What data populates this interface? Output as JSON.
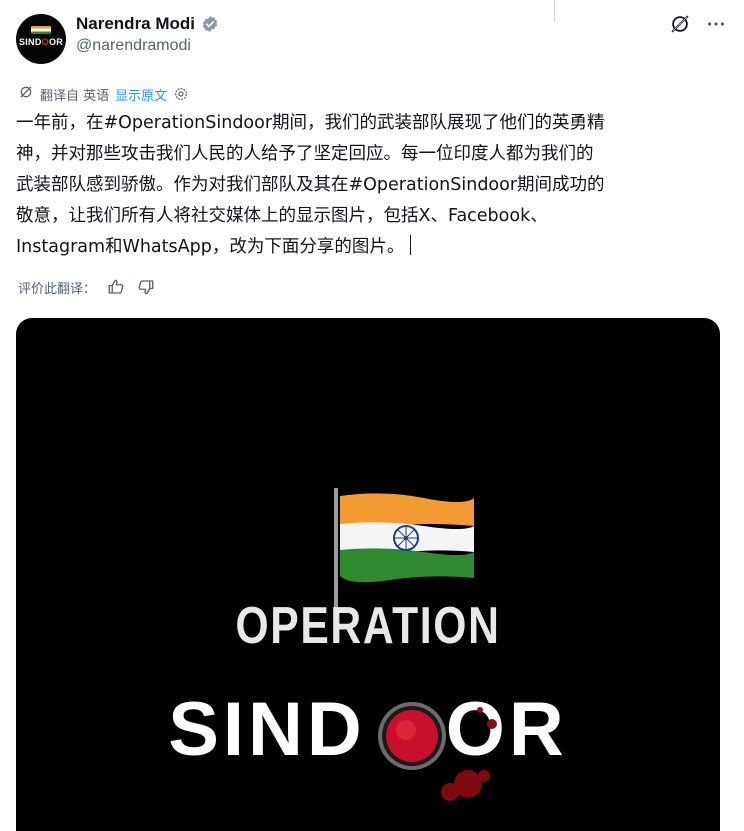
{
  "author": {
    "display_name": "Narendra Modi",
    "handle": "@narendramodi",
    "avatar_text_a": "SIND",
    "avatar_text_o": "O",
    "avatar_text_b": "OR"
  },
  "translation": {
    "translated_from": "翻译自 英语",
    "show_original": "显示原文",
    "rate_label": "评价此翻译："
  },
  "tweet": {
    "text": "一年前，在#OperationSindoor期间，我们的武装部队展现了他们的英勇精\n神，并对那些攻击我们人民的人给予了坚定回应。每一位印度人都为我们的\n武装部队感到骄傲。作为对我们部队及其在#OperationSindoor期间成功的\n敬意，让我们所有人将社交媒体上的显示图片，包括X、Facebook、\nInstagram和WhatsApp，改为下面分享的图片。"
  },
  "media": {
    "line1": "OPERATION",
    "line2_part_a": "SIND",
    "line2_part_b": "OR"
  },
  "icons": {
    "verified": "verified-badge-icon",
    "grok": "grok-icon",
    "more": "more-icon",
    "translate": "translate-icon",
    "settings": "settings-icon",
    "thumbs_up": "thumbs-up-icon",
    "thumbs_down": "thumbs-down-icon"
  },
  "colors": {
    "accent": "#1d9bf0",
    "text": "#0f1419",
    "muted": "#536471",
    "saffron": "#f39a33",
    "green": "#2f8a2f",
    "sindoor_red": "#c8102e"
  }
}
